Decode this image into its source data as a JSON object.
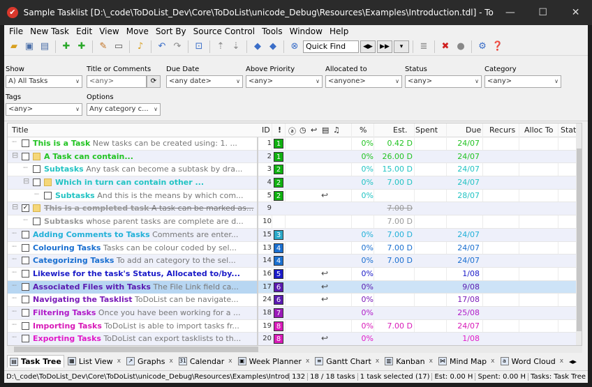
{
  "window": {
    "title": "Sample Tasklist [D:\\_code\\ToDoList_Dev\\Core\\ToDoList\\unicode_Debug\\Resources\\Examples\\Introduction.tdl] - ToDoList (c) AbstractSp...",
    "minimize": "—",
    "maximize": "☐",
    "close": "✕"
  },
  "menu": [
    "File",
    "New Task",
    "Edit",
    "View",
    "Move",
    "Sort By",
    "Source Control",
    "Tools",
    "Window",
    "Help"
  ],
  "toolbar": {
    "quick_find": "Quick Find"
  },
  "filters": {
    "show_label": "Show",
    "show_value": "A)  All Tasks",
    "title_label": "Title or Comments",
    "title_value": "<any>",
    "due_label": "Due Date",
    "due_value": "<any date>",
    "priority_label": "Above Priority",
    "priority_value": "<any>",
    "allocated_label": "Allocated to",
    "allocated_value": "<anyone>",
    "status_label": "Status",
    "status_value": "<any>",
    "category_label": "Category",
    "category_value": "<any>",
    "tags_label": "Tags",
    "tags_value": "<any>",
    "options_label": "Options",
    "options_value": "Any category c..."
  },
  "columns": {
    "title": "Title",
    "id": "ID",
    "priority": "!",
    "pct": "%",
    "est": "Est.",
    "spent": "Spent",
    "due": "Due",
    "recurs": "Recurs",
    "alloc": "Alloc To",
    "status": "Stat"
  },
  "tasks": [
    {
      "indent": 0,
      "title": "This is a Task",
      "comment": "New tasks can be created using:  1. ...",
      "color": "#22c322",
      "id": "1",
      "prio": "1",
      "prio_color": "#10b010",
      "pct": "0%",
      "est": "0.42 D",
      "due": "24/07",
      "done": false,
      "folder": false,
      "link": false
    },
    {
      "indent": 0,
      "title": "A Task can contain...",
      "comment": "",
      "color": "#22c322",
      "id": "2",
      "prio": "1",
      "prio_color": "#10b010",
      "pct": "0%",
      "est": "26.00 D",
      "due": "24/07",
      "done": false,
      "folder": true,
      "link": false
    },
    {
      "indent": 1,
      "title": "Subtasks",
      "comment": "Any task can become a subtask by dra...",
      "color": "#22c3c3",
      "id": "3",
      "prio": "2",
      "prio_color": "#10b010",
      "pct": "0%",
      "est": "15.00 D",
      "due": "24/07",
      "done": false,
      "folder": false,
      "link": false
    },
    {
      "indent": 1,
      "title": "Which in turn can contain other ...",
      "comment": "",
      "color": "#22c3c3",
      "id": "4",
      "prio": "2",
      "prio_color": "#10b010",
      "pct": "0%",
      "est": "7.00 D",
      "due": "24/07",
      "done": false,
      "folder": true,
      "link": false
    },
    {
      "indent": 2,
      "title": "Subtasks",
      "comment": "And this is the means by which com...",
      "color": "#22c3c3",
      "id": "5",
      "prio": "2",
      "prio_color": "#10b010",
      "pct": "0%",
      "est": "",
      "due": "28/07",
      "done": false,
      "folder": false,
      "link": true
    },
    {
      "indent": 0,
      "title": "This is a completed task",
      "comment": "A task can be marked as...",
      "color": "#999999",
      "id": "9",
      "prio": "",
      "prio_color": "",
      "pct": "",
      "est": "7.00 D",
      "due": "",
      "done": true,
      "folder": true,
      "link": false
    },
    {
      "indent": 1,
      "title": "Subtasks",
      "comment": "whose parent tasks are complete are d...",
      "color": "#999999",
      "id": "10",
      "prio": "",
      "prio_color": "",
      "pct": "",
      "est": "7.00 D",
      "due": "",
      "done": false,
      "folder": false,
      "link": false
    },
    {
      "indent": 0,
      "title": "Adding Comments to Tasks",
      "comment": "Comments are enter...",
      "color": "#22b0d8",
      "id": "15",
      "prio": "3",
      "prio_color": "#2aa8c8",
      "pct": "0%",
      "est": "7.00 D",
      "due": "24/07",
      "done": false,
      "folder": false,
      "link": false
    },
    {
      "indent": 0,
      "title": "Colouring Tasks",
      "comment": "Tasks can be colour coded by sel...",
      "color": "#1a6fd0",
      "id": "13",
      "prio": "4",
      "prio_color": "#1a6fd0",
      "pct": "0%",
      "est": "7.00 D",
      "due": "24/07",
      "done": false,
      "folder": false,
      "link": false
    },
    {
      "indent": 0,
      "title": "Categorizing Tasks",
      "comment": "To add an category to the sel...",
      "color": "#1a6fd0",
      "id": "14",
      "prio": "4",
      "prio_color": "#1a6fd0",
      "pct": "0%",
      "est": "7.00 D",
      "due": "24/07",
      "done": false,
      "folder": false,
      "link": false
    },
    {
      "indent": 0,
      "title": "Likewise for the task's Status, Allocated to/by...",
      "comment": "",
      "color": "#1a1ac8",
      "id": "16",
      "prio": "5",
      "prio_color": "#1a1ac8",
      "pct": "0%",
      "est": "",
      "due": "1/08",
      "done": false,
      "folder": false,
      "link": true
    },
    {
      "indent": 0,
      "title": "Associated Files with Tasks",
      "comment": "The File Link field ca...",
      "color": "#5a1ab0",
      "id": "17",
      "prio": "6",
      "prio_color": "#5a1ab0",
      "pct": "0%",
      "est": "",
      "due": "9/08",
      "done": false,
      "folder": false,
      "link": true,
      "selected": true
    },
    {
      "indent": 0,
      "title": "Navigating the Tasklist",
      "comment": "ToDoList can be navigate...",
      "color": "#7a1ab8",
      "id": "24",
      "prio": "6",
      "prio_color": "#5a1ab0",
      "pct": "0%",
      "est": "",
      "due": "17/08",
      "done": false,
      "folder": false,
      "link": true
    },
    {
      "indent": 0,
      "title": "Filtering Tasks",
      "comment": "Once you have been working for a ...",
      "color": "#b01ac8",
      "id": "18",
      "prio": "7",
      "prio_color": "#9a1ab8",
      "pct": "0%",
      "est": "",
      "due": "25/08",
      "done": false,
      "folder": false,
      "link": false
    },
    {
      "indent": 0,
      "title": "Importing Tasks",
      "comment": "ToDoList is able to import tasks fr...",
      "color": "#d81ab8",
      "id": "19",
      "prio": "8",
      "prio_color": "#d81ab8",
      "pct": "0%",
      "est": "7.00 D",
      "due": "24/07",
      "done": false,
      "folder": false,
      "link": false
    },
    {
      "indent": 0,
      "title": "Exporting Tasks",
      "comment": "ToDoList can export tasklists to th...",
      "color": "#e01ac8",
      "id": "20",
      "prio": "8",
      "prio_color": "#d81ab8",
      "pct": "0%",
      "est": "",
      "due": "1/08",
      "done": false,
      "folder": false,
      "link": true
    }
  ],
  "tabs": [
    "Task Tree",
    "List View",
    "Graphs",
    "Calendar",
    "Week Planner",
    "Gantt Chart",
    "Kanban",
    "Mind Map",
    "Word Cloud"
  ],
  "status": {
    "path": "D:\\_code\\ToDoList_Dev\\Core\\ToDoList\\unicode_Debug\\Resources\\Examples\\Introduction.tdl",
    "count": "132",
    "tasks": "18 / 18 tasks",
    "selected": "1 task selected (17)",
    "est": "Est: 0.00 H",
    "spent": "Spent: 0.00 H",
    "view": "Tasks: Task Tree"
  },
  "colors": {
    "completed": "#999999",
    "selected_row": "#cde3f7"
  }
}
